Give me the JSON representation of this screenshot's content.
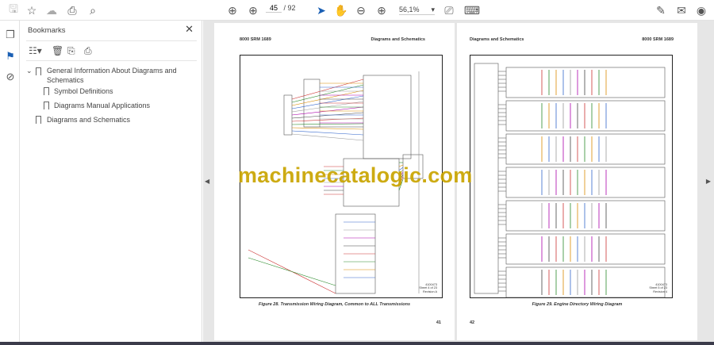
{
  "toolbar": {
    "page_current": "45",
    "page_total": "/ 92",
    "zoom": "56,1%"
  },
  "bookmarks": {
    "title": "Bookmarks",
    "items": [
      {
        "label": "General Information About Diagrams and",
        "label2": "Schematics"
      },
      {
        "label": "Symbol Definitions"
      },
      {
        "label": "Diagrams Manual Applications"
      },
      {
        "label": "Diagrams and Schematics"
      }
    ]
  },
  "pages": [
    {
      "header_left": "8000 SRM 1689",
      "header_right": "Diagrams and Schematics",
      "caption": "Figure 28. Transmission Wiring Diagram, Common to ALL Transmissions",
      "number": "41",
      "rev": [
        "4100473",
        "Sheet 4 of 23",
        "Revision A"
      ]
    },
    {
      "header_left": "Diagrams and Schematics",
      "header_right": "8000 SRM 1689",
      "caption": "Figure 29. Engine Directory Wiring Diagram",
      "number": "42",
      "rev": [
        "4100473",
        "Sheet 5 of 23",
        "Revision 4"
      ]
    }
  ],
  "watermark": "machinecatalogic.com",
  "colors": {
    "watermark": "#c9a400",
    "selection": "#1a5fb4"
  }
}
